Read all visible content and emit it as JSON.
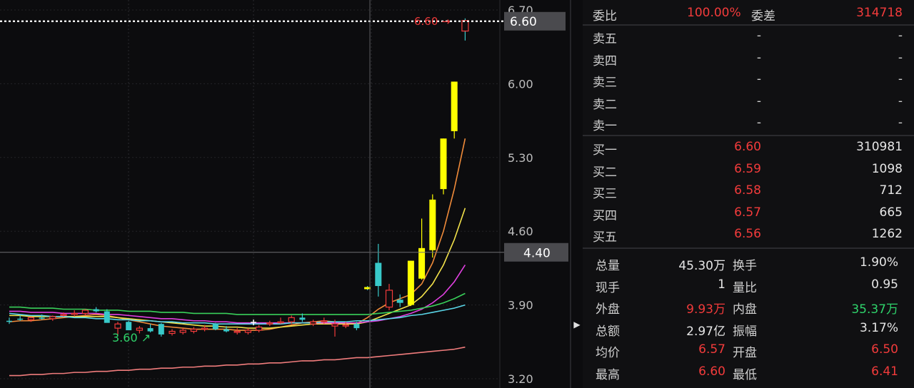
{
  "chart_data": {
    "type": "candlestick",
    "y_ticks": [
      "6.70",
      "6.00",
      "5.30",
      "4.60",
      "3.90",
      "3.20"
    ],
    "ylim": [
      3.2,
      6.7
    ],
    "current_price_label": "6.60",
    "cursor_price_label": "4.40",
    "cursor_price": 4.4,
    "high_annotation": "6.60",
    "low_annotation": "3.60",
    "candles": [
      {
        "o": 3.75,
        "h": 3.78,
        "l": 3.72,
        "c": 3.74,
        "up": false
      },
      {
        "o": 3.77,
        "h": 3.8,
        "l": 3.75,
        "c": 3.76,
        "up": false
      },
      {
        "o": 3.76,
        "h": 3.79,
        "l": 3.74,
        "c": 3.78,
        "up": true
      },
      {
        "o": 3.78,
        "h": 3.81,
        "l": 3.76,
        "c": 3.77,
        "up": false
      },
      {
        "o": 3.77,
        "h": 3.8,
        "l": 3.75,
        "c": 3.79,
        "up": true
      },
      {
        "o": 3.8,
        "h": 3.83,
        "l": 3.79,
        "c": 3.81,
        "up": true
      },
      {
        "o": 3.82,
        "h": 3.85,
        "l": 3.79,
        "c": 3.82,
        "up": true
      },
      {
        "o": 3.82,
        "h": 3.86,
        "l": 3.8,
        "c": 3.85,
        "up": true
      },
      {
        "o": 3.86,
        "h": 3.88,
        "l": 3.83,
        "c": 3.84,
        "up": false
      },
      {
        "o": 3.84,
        "h": 3.86,
        "l": 3.76,
        "c": 3.73,
        "up": false
      },
      {
        "o": 3.72,
        "h": 3.74,
        "l": 3.62,
        "c": 3.68,
        "up": true
      },
      {
        "o": 3.74,
        "h": 3.75,
        "l": 3.66,
        "c": 3.66,
        "up": false
      },
      {
        "o": 3.66,
        "h": 3.7,
        "l": 3.63,
        "c": 3.68,
        "up": true
      },
      {
        "o": 3.68,
        "h": 3.72,
        "l": 3.64,
        "c": 3.65,
        "up": false
      },
      {
        "o": 3.72,
        "h": 3.73,
        "l": 3.6,
        "c": 3.62,
        "up": false
      },
      {
        "o": 3.63,
        "h": 3.67,
        "l": 3.61,
        "c": 3.65,
        "up": true
      },
      {
        "o": 3.64,
        "h": 3.68,
        "l": 3.62,
        "c": 3.66,
        "up": true
      },
      {
        "o": 3.65,
        "h": 3.69,
        "l": 3.63,
        "c": 3.67,
        "up": true
      },
      {
        "o": 3.67,
        "h": 3.71,
        "l": 3.65,
        "c": 3.68,
        "up": true
      },
      {
        "o": 3.72,
        "h": 3.73,
        "l": 3.66,
        "c": 3.67,
        "up": false
      },
      {
        "o": 3.67,
        "h": 3.7,
        "l": 3.64,
        "c": 3.65,
        "up": false
      },
      {
        "o": 3.65,
        "h": 3.68,
        "l": 3.62,
        "c": 3.65,
        "up": true
      },
      {
        "o": 3.64,
        "h": 3.68,
        "l": 3.62,
        "c": 3.66,
        "up": true
      },
      {
        "o": 3.66,
        "h": 3.71,
        "l": 3.64,
        "c": 3.69,
        "up": true
      },
      {
        "o": 3.73,
        "h": 3.75,
        "l": 3.7,
        "c": 3.73,
        "up": true
      },
      {
        "o": 3.74,
        "h": 3.78,
        "l": 3.72,
        "c": 3.74,
        "up": true
      },
      {
        "o": 3.74,
        "h": 3.8,
        "l": 3.72,
        "c": 3.78,
        "up": true
      },
      {
        "o": 3.78,
        "h": 3.82,
        "l": 3.74,
        "c": 3.76,
        "up": false
      },
      {
        "o": 3.72,
        "h": 3.76,
        "l": 3.7,
        "c": 3.74,
        "up": true
      },
      {
        "o": 3.75,
        "h": 3.78,
        "l": 3.72,
        "c": 3.75,
        "up": true
      },
      {
        "o": 3.72,
        "h": 3.76,
        "l": 3.6,
        "c": 3.7,
        "up": true
      },
      {
        "o": 3.71,
        "h": 3.74,
        "l": 3.68,
        "c": 3.71,
        "up": true
      },
      {
        "o": 3.72,
        "h": 3.74,
        "l": 3.66,
        "c": 3.68,
        "up": false
      },
      {
        "o": 4.07,
        "h": 4.08,
        "l": 4.04,
        "c": 4.05,
        "up": false
      },
      {
        "o": 4.3,
        "h": 4.48,
        "l": 3.98,
        "c": 4.08,
        "up": false
      },
      {
        "o": 3.88,
        "h": 4.1,
        "l": 3.85,
        "c": 4.04,
        "up": true
      },
      {
        "o": 3.95,
        "h": 4.0,
        "l": 3.88,
        "c": 3.92,
        "up": false
      },
      {
        "o": 3.9,
        "h": 4.32,
        "l": 3.89,
        "c": 4.32,
        "up": true
      },
      {
        "o": 4.15,
        "h": 4.72,
        "l": 4.14,
        "c": 4.44,
        "up": true
      },
      {
        "o": 4.42,
        "h": 4.95,
        "l": 4.35,
        "c": 4.9,
        "up": true
      },
      {
        "o": 5.0,
        "h": 5.48,
        "l": 4.95,
        "c": 5.48,
        "up": true
      },
      {
        "o": 5.55,
        "h": 6.02,
        "l": 5.48,
        "c": 6.02,
        "up": true
      },
      {
        "o": 6.6,
        "h": 6.62,
        "l": 6.41,
        "c": 6.5,
        "up": false
      }
    ],
    "ma_lines": [
      {
        "color": "#f08b3a",
        "values": [
          3.74,
          3.75,
          3.75,
          3.76,
          3.77,
          3.78,
          3.79,
          3.8,
          3.81,
          3.8,
          3.78,
          3.76,
          3.74,
          3.72,
          3.7,
          3.69,
          3.68,
          3.67,
          3.67,
          3.67,
          3.67,
          3.66,
          3.66,
          3.66,
          3.67,
          3.69,
          3.71,
          3.73,
          3.74,
          3.75,
          3.74,
          3.73,
          3.72,
          3.78,
          3.86,
          3.92,
          3.96,
          4.0,
          4.1,
          4.3,
          4.6,
          5.0,
          5.48
        ]
      },
      {
        "color": "#f3e24a",
        "values": [
          3.8,
          3.8,
          3.79,
          3.79,
          3.79,
          3.79,
          3.79,
          3.79,
          3.79,
          3.79,
          3.78,
          3.77,
          3.76,
          3.75,
          3.74,
          3.73,
          3.72,
          3.71,
          3.7,
          3.7,
          3.69,
          3.69,
          3.68,
          3.68,
          3.68,
          3.69,
          3.7,
          3.71,
          3.72,
          3.72,
          3.72,
          3.72,
          3.72,
          3.74,
          3.78,
          3.82,
          3.86,
          3.9,
          3.98,
          4.1,
          4.28,
          4.52,
          4.82
        ]
      },
      {
        "color": "#e040e0",
        "values": [
          3.84,
          3.84,
          3.83,
          3.83,
          3.83,
          3.82,
          3.82,
          3.82,
          3.82,
          3.81,
          3.81,
          3.8,
          3.79,
          3.78,
          3.77,
          3.77,
          3.76,
          3.75,
          3.75,
          3.74,
          3.74,
          3.73,
          3.73,
          3.73,
          3.73,
          3.73,
          3.73,
          3.73,
          3.73,
          3.73,
          3.73,
          3.73,
          3.73,
          3.74,
          3.75,
          3.77,
          3.79,
          3.82,
          3.86,
          3.92,
          4.0,
          4.12,
          4.28
        ]
      },
      {
        "color": "#39d05a",
        "values": [
          3.88,
          3.88,
          3.87,
          3.87,
          3.87,
          3.86,
          3.86,
          3.86,
          3.85,
          3.85,
          3.85,
          3.84,
          3.84,
          3.84,
          3.83,
          3.83,
          3.83,
          3.82,
          3.82,
          3.82,
          3.82,
          3.81,
          3.81,
          3.81,
          3.81,
          3.81,
          3.81,
          3.81,
          3.81,
          3.81,
          3.81,
          3.81,
          3.81,
          3.81,
          3.82,
          3.83,
          3.84,
          3.85,
          3.87,
          3.89,
          3.92,
          3.96,
          4.01
        ]
      },
      {
        "color": "#5ad6e8",
        "values": [
          3.82,
          3.81,
          3.8,
          3.8,
          3.79,
          3.79,
          3.78,
          3.78,
          3.77,
          3.77,
          3.76,
          3.76,
          3.75,
          3.75,
          3.74,
          3.74,
          3.73,
          3.73,
          3.73,
          3.72,
          3.72,
          3.72,
          3.72,
          3.72,
          3.72,
          3.72,
          3.73,
          3.73,
          3.73,
          3.74,
          3.74,
          3.74,
          3.75,
          3.75,
          3.76,
          3.77,
          3.78,
          3.8,
          3.81,
          3.83,
          3.85,
          3.87,
          3.9
        ]
      },
      {
        "color": "#f07c7c",
        "values": [
          3.23,
          3.23,
          3.24,
          3.24,
          3.25,
          3.25,
          3.26,
          3.26,
          3.27,
          3.27,
          3.28,
          3.28,
          3.29,
          3.29,
          3.3,
          3.3,
          3.31,
          3.31,
          3.32,
          3.32,
          3.33,
          3.33,
          3.34,
          3.34,
          3.35,
          3.35,
          3.36,
          3.37,
          3.37,
          3.38,
          3.38,
          3.39,
          3.4,
          3.4,
          3.41,
          3.42,
          3.43,
          3.44,
          3.45,
          3.46,
          3.47,
          3.48,
          3.5
        ]
      }
    ]
  },
  "panel": {
    "weibi_label": "委比",
    "weibi_value": "100.00%",
    "weicha_label": "委差",
    "weicha_value": "314718",
    "sell_rows": [
      {
        "label": "卖五",
        "price": "-",
        "vol": "-"
      },
      {
        "label": "卖四",
        "price": "-",
        "vol": "-"
      },
      {
        "label": "卖三",
        "price": "-",
        "vol": "-"
      },
      {
        "label": "卖二",
        "price": "-",
        "vol": "-"
      },
      {
        "label": "卖一",
        "price": "-",
        "vol": "-"
      }
    ],
    "buy_rows": [
      {
        "label": "买一",
        "price": "6.60",
        "vol": "310981"
      },
      {
        "label": "买二",
        "price": "6.59",
        "vol": "1098"
      },
      {
        "label": "买三",
        "price": "6.58",
        "vol": "712"
      },
      {
        "label": "买四",
        "price": "6.57",
        "vol": "665"
      },
      {
        "label": "买五",
        "price": "6.56",
        "vol": "1262"
      }
    ],
    "stats": [
      {
        "l1": "总量",
        "v1": "45.30万",
        "c1": "white",
        "l2": "换手",
        "v2": "1.90%",
        "c2": "white"
      },
      {
        "l1": "现手",
        "v1": "1",
        "c1": "white",
        "l2": "量比",
        "v2": "0.95",
        "c2": "white"
      },
      {
        "l1": "外盘",
        "v1": "9.93万",
        "c1": "red",
        "l2": "内盘",
        "v2": "35.37万",
        "c2": "green"
      },
      {
        "l1": "总额",
        "v1": "2.97亿",
        "c1": "white",
        "l2": "振幅",
        "v2": "3.17%",
        "c2": "white"
      },
      {
        "l1": "均价",
        "v1": "6.57",
        "c1": "red",
        "l2": "开盘",
        "v2": "6.50",
        "c2": "red"
      },
      {
        "l1": "最高",
        "v1": "6.60",
        "c1": "red",
        "l2": "最低",
        "v2": "6.41",
        "c2": "red"
      }
    ],
    "colors": {
      "red": "#f23b3b",
      "green": "#2fd36b",
      "cyan": "#38c9c9",
      "yellow": "#ffff00"
    }
  }
}
